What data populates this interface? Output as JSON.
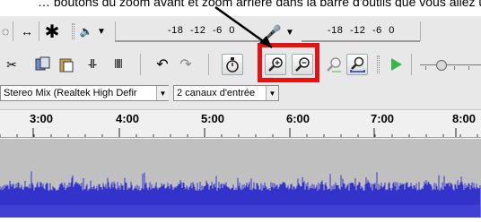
{
  "caption": {
    "text": "… boutons du zoom avant et zoom arrière dans la barre d'outils que vous allez utiliser ici pour afficher …"
  },
  "annotation": {
    "highlight_color": "#e81010",
    "highlight_target": "zoom-buttons"
  },
  "toolbar_row1": {
    "tools": [
      "selection-tool-icon",
      "time-shift-tool-icon",
      "multi-tool-icon"
    ],
    "playback_meter_icon": "speaker-icon",
    "playback_meter_scale": [
      "-18",
      "-12",
      "-6",
      "0"
    ],
    "recording_meter_icon": "microphone-icon",
    "recording_meter_scale": [
      "-18",
      "-12",
      "-6",
      "0"
    ]
  },
  "toolbar_row2": {
    "edit_tools": [
      "cut-icon",
      "copy-icon",
      "paste-icon",
      "trim-icon",
      "silence-icon"
    ],
    "undo_icon": "undo-icon",
    "redo_icon": "redo-icon",
    "sync_lock_icon": "sync-lock-icon",
    "zoom_in_icon": "zoom-in-icon",
    "zoom_out_icon": "zoom-out-icon",
    "fit_selection_icon": "fit-selection-icon",
    "fit_project_icon": "fit-project-icon",
    "play_at_speed_icon": "play-at-speed-icon",
    "speed_slider_icon": "speed-slider"
  },
  "devices": {
    "recording_device": "Stereo Mix (Realtek High Defir",
    "recording_channels": "2 canaux d'entrée"
  },
  "timeline": {
    "labels": [
      "3:00",
      "4:00",
      "5:00",
      "6:00",
      "7:00",
      "8:00"
    ]
  },
  "track": {
    "waveform_color": "#3333cc",
    "background_color": "#c0c0c0"
  }
}
